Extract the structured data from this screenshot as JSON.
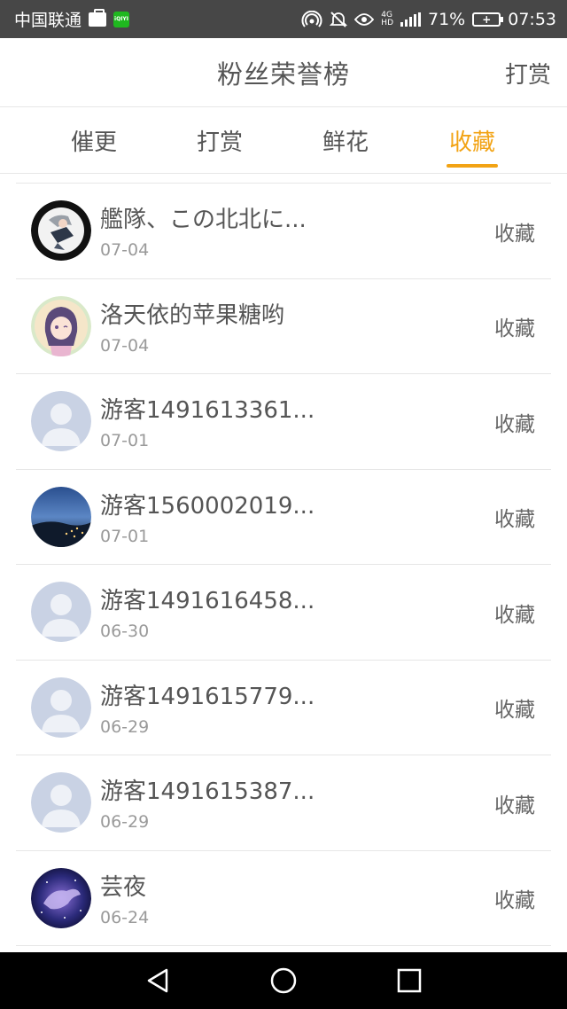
{
  "status_bar": {
    "carrier": "中国联通",
    "app_badge": "iQIYI",
    "network": "4G",
    "network_sub": "HD",
    "battery_percent": "71%",
    "time": "07:53"
  },
  "header": {
    "title": "粉丝荣誉榜",
    "action_label": "打赏"
  },
  "tabs": [
    {
      "label": "催更",
      "active": false
    },
    {
      "label": "打赏",
      "active": false
    },
    {
      "label": "鲜花",
      "active": false
    },
    {
      "label": "收藏",
      "active": true
    }
  ],
  "accent_color": "#f2a314",
  "list": {
    "items": [
      {
        "name": "艦隊、この北北に...",
        "date": "07-04",
        "action": "收藏",
        "avatar": "anime-boy-avatar"
      },
      {
        "name": "洛天依的苹果糖哟",
        "date": "07-04",
        "action": "收藏",
        "avatar": "anime-girl-avatar"
      },
      {
        "name": "游客1491613361...",
        "date": "07-01",
        "action": "收藏",
        "avatar": "default-user-avatar"
      },
      {
        "name": "游客1560002019...",
        "date": "07-01",
        "action": "收藏",
        "avatar": "night-city-avatar"
      },
      {
        "name": "游客1491616458...",
        "date": "06-30",
        "action": "收藏",
        "avatar": "default-user-avatar"
      },
      {
        "name": "游客1491615779...",
        "date": "06-29",
        "action": "收藏",
        "avatar": "default-user-avatar"
      },
      {
        "name": "游客1491615387...",
        "date": "06-29",
        "action": "收藏",
        "avatar": "default-user-avatar"
      },
      {
        "name": "芸夜",
        "date": "06-24",
        "action": "收藏",
        "avatar": "galaxy-pegasus-avatar"
      }
    ]
  },
  "navbar": {
    "icons": [
      "back-icon",
      "home-icon",
      "recents-icon"
    ]
  }
}
